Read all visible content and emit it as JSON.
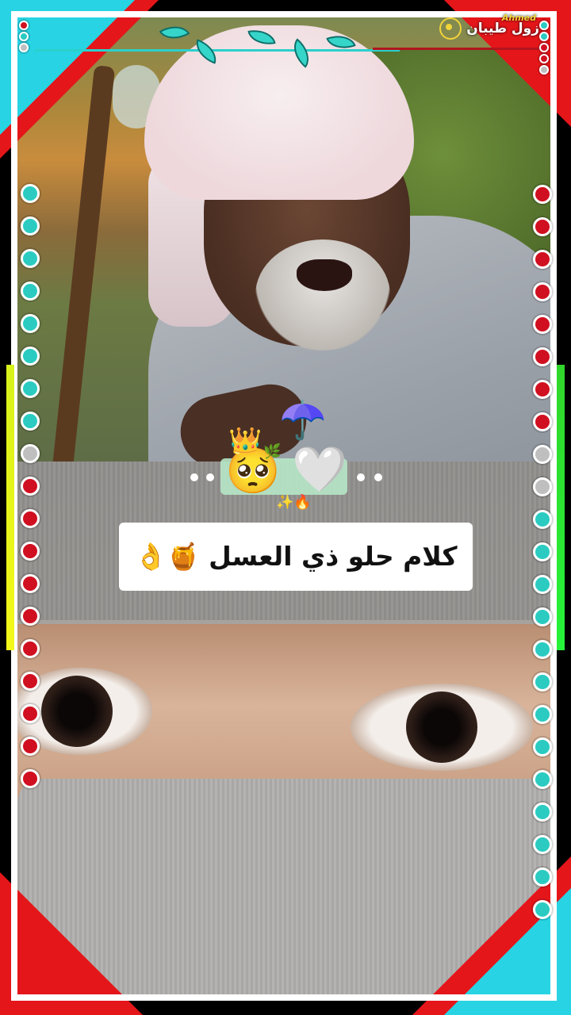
{
  "video": {
    "caption": "كلام حلو ذي العسل 🍯👌",
    "watermark_name": "زول طيبان",
    "watermark_signature": "Ahmed"
  },
  "sticker": {
    "face_emoji": "🥺",
    "heart_emoji": "🤍",
    "crown_emoji": "👑",
    "umbrella_emoji": "☂️",
    "leaf_emoji": "🌿",
    "fire_emoji": "🔥",
    "sparkle_emoji": "✨"
  },
  "decor": {
    "accent_cyan": "#2bcbc1",
    "accent_red": "#d01020",
    "left_dots": [
      "cyan",
      "cyan",
      "cyan",
      "cyan",
      "cyan",
      "cyan",
      "cyan",
      "cyan",
      "gray",
      "red",
      "red",
      "red",
      "red",
      "red",
      "red",
      "red",
      "red",
      "red",
      "red"
    ],
    "right_dots": [
      "red",
      "red",
      "red",
      "red",
      "red",
      "red",
      "red",
      "red",
      "gray",
      "gray",
      "cyan",
      "cyan",
      "cyan",
      "cyan",
      "cyan",
      "cyan",
      "cyan",
      "cyan",
      "cyan",
      "cyan",
      "cyan",
      "cyan",
      "cyan"
    ]
  },
  "icons": [
    "camera-icon",
    "vine-ornament",
    "corner-accent"
  ]
}
